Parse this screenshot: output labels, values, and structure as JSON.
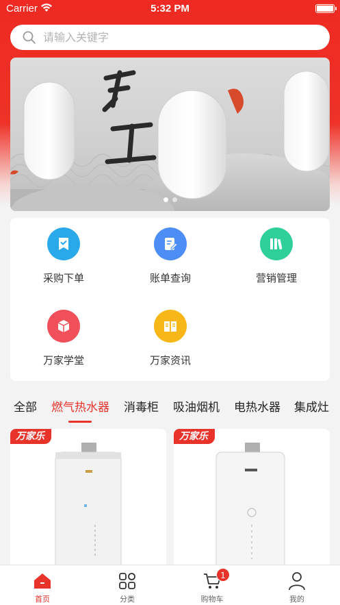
{
  "status": {
    "carrier": "Carrier",
    "time": "5:32 PM"
  },
  "search": {
    "placeholder": "请输入关键字"
  },
  "banner": {
    "slide_count": 2,
    "active_slide": 1
  },
  "menu": {
    "items": [
      {
        "label": "采购下单",
        "icon": "purchase-order-icon",
        "color": "#29a9ea"
      },
      {
        "label": "账单查询",
        "icon": "bill-query-icon",
        "color": "#4c8df6"
      },
      {
        "label": "营销管理",
        "icon": "marketing-books-icon",
        "color": "#2fcf9a"
      },
      {
        "label": "万家学堂",
        "icon": "school-box-icon",
        "color": "#f0505a"
      },
      {
        "label": "万家资讯",
        "icon": "news-book-icon",
        "color": "#f7b718"
      }
    ]
  },
  "categories": {
    "items": [
      "全部",
      "燃气热水器",
      "消毒柜",
      "吸油烟机",
      "电热水器",
      "集成灶"
    ],
    "active_index": 1
  },
  "products": [
    {
      "brand": "万家乐"
    },
    {
      "brand": "万家乐"
    }
  ],
  "tabbar": {
    "items": [
      {
        "label": "首页",
        "icon": "home-icon"
      },
      {
        "label": "分类",
        "icon": "category-grid-icon"
      },
      {
        "label": "购物车",
        "icon": "cart-icon",
        "badge": "1"
      },
      {
        "label": "我的",
        "icon": "profile-icon"
      }
    ],
    "active_index": 0
  },
  "colors": {
    "accent": "#e8332a",
    "background": "#f3f3f3"
  }
}
